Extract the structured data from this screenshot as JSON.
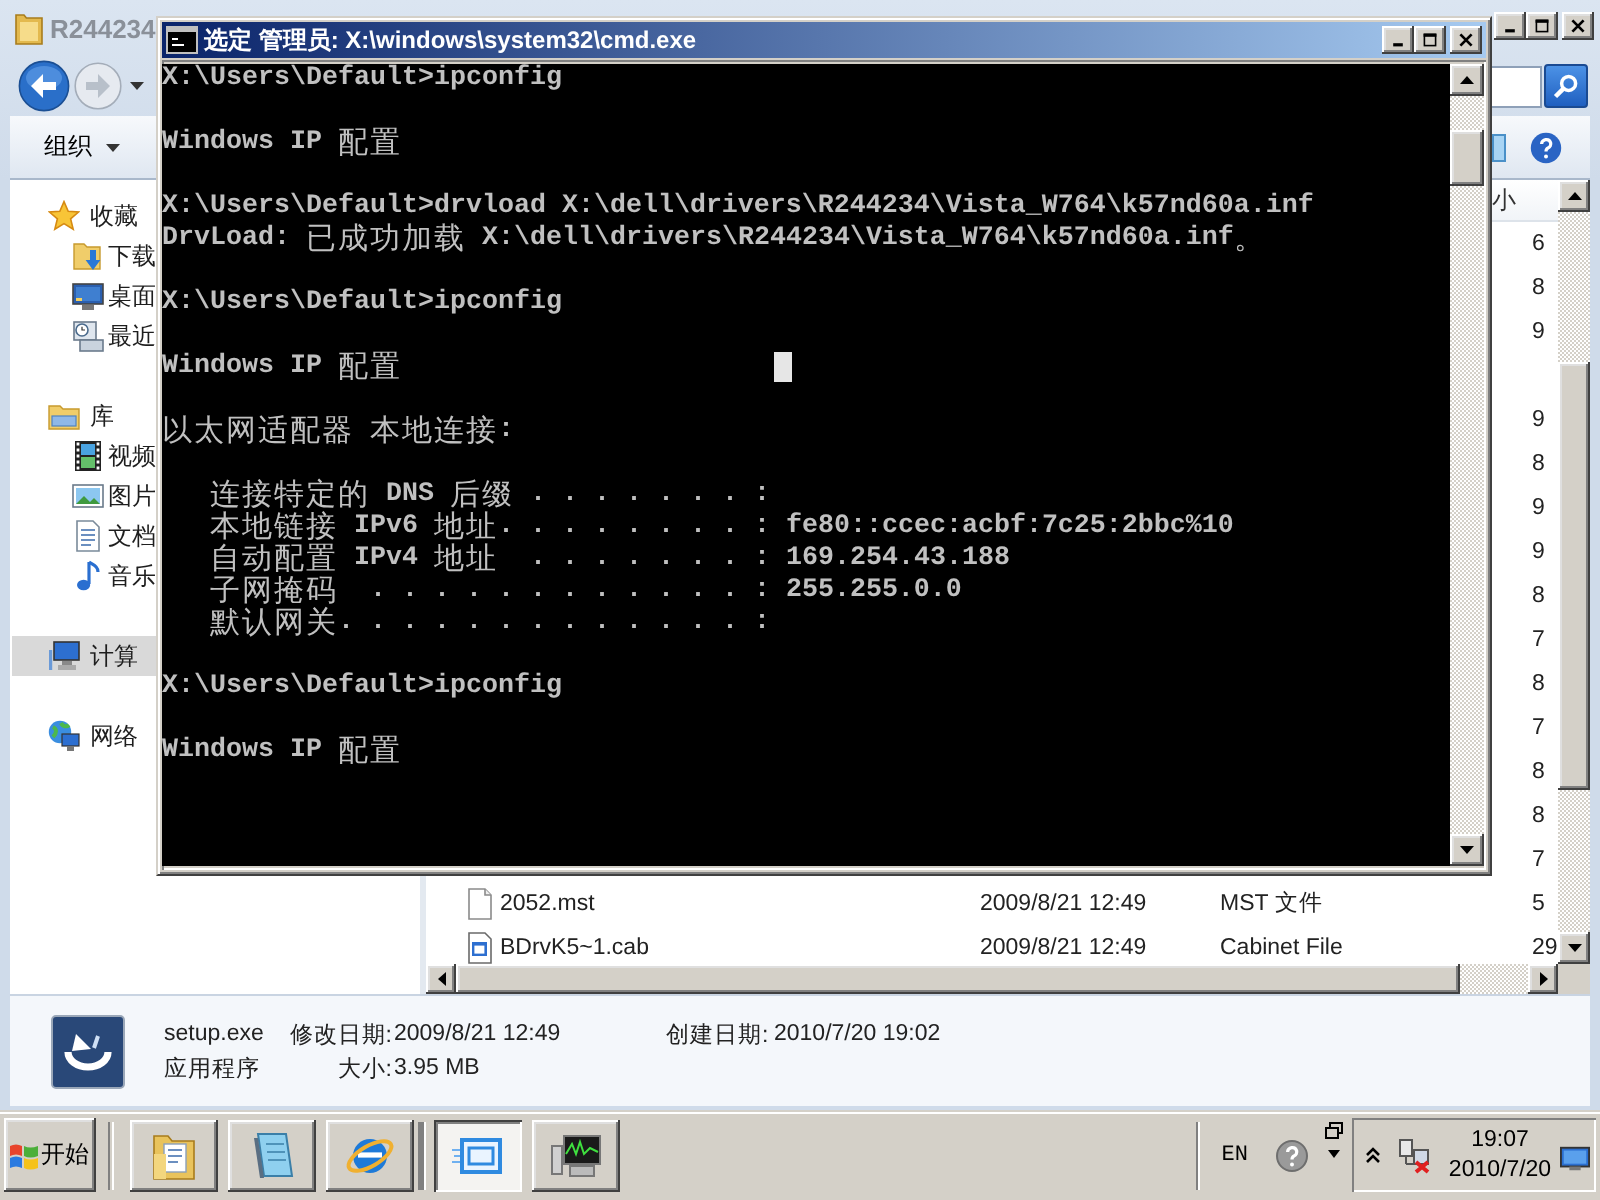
{
  "explorer": {
    "title": "R244234",
    "toolbar": {
      "organize": "组织"
    },
    "sidebar": [
      {
        "label": "收藏",
        "selected": false,
        "children": [
          {
            "label": "下载",
            "selected": false
          },
          {
            "label": "桌面",
            "selected": false
          },
          {
            "label": "最近",
            "selected": false
          }
        ]
      },
      {
        "label": "库",
        "selected": false,
        "children": [
          {
            "label": "视频",
            "selected": false
          },
          {
            "label": "图片",
            "selected": false
          },
          {
            "label": "文档",
            "selected": false
          },
          {
            "label": "音乐",
            "selected": false
          }
        ]
      },
      {
        "label": "计算",
        "selected": true
      },
      {
        "label": "网络",
        "selected": false
      }
    ],
    "file_list": {
      "columns": [
        {
          "label": "小"
        }
      ],
      "rows": [
        {
          "size": "6"
        },
        {
          "size": "8"
        },
        {
          "size": "9"
        },
        {
          "size": "9"
        },
        {
          "size": "8"
        },
        {
          "size": "9"
        },
        {
          "size": "9"
        },
        {
          "size": "8"
        },
        {
          "size": "7"
        },
        {
          "size": "8"
        },
        {
          "size": "7"
        },
        {
          "size": "8"
        },
        {
          "size": "8"
        },
        {
          "size": "7"
        },
        {
          "name": "2052.mst",
          "date": "2009/8/21 12:49",
          "type": "MST 文件",
          "size": "5"
        },
        {
          "name": "BDrvK5~1.cab",
          "date": "2009/8/21 12:49",
          "type": "Cabinet File",
          "size": "29"
        }
      ]
    },
    "details": {
      "name": "setup.exe",
      "modified_label": "修改日期:",
      "modified": "2009/8/21 12:49",
      "created_label": "创建日期:",
      "created": "2010/7/20 19:02",
      "type": "应用程序",
      "size_label": "大小:",
      "size": "3.95 MB"
    }
  },
  "console_window": {
    "title": "选定 管理员: X:\\windows\\system32\\cmd.exe",
    "lines": [
      {
        "kind": "prompt",
        "text": "X:\\Users\\Default>ipconfig"
      },
      {
        "kind": "heading",
        "text": "Windows IP 配置"
      },
      {
        "kind": "prompt",
        "text": "X:\\Users\\Default>drvload X:\\dell\\drivers\\R244234\\Vista_W764\\k57nd60a.inf"
      },
      {
        "kind": "output",
        "text": "DrvLoad: 已成功加载 X:\\dell\\drivers\\R244234\\Vista_W764\\k57nd60a.inf。"
      },
      {
        "kind": "prompt",
        "text": "X:\\Users\\Default>ipconfig"
      },
      {
        "kind": "heading",
        "text": "Windows IP 配置"
      },
      {
        "kind": "heading",
        "text": "以太网适配器 本地连接:"
      },
      {
        "kind": "field",
        "text": "连接特定的 DNS 后缀 . . . . . . . :"
      },
      {
        "kind": "field",
        "text": "本地链接 IPv6 地址. . . . . . . . : fe80::ccec:acbf:7c25:2bbc%10"
      },
      {
        "kind": "field",
        "text": "自动配置 IPv4 地址  . . . . . . . : 169.254.43.188"
      },
      {
        "kind": "field",
        "text": "子网掩码  . . . . . . . . . . . . : 255.255.0.0"
      },
      {
        "kind": "field",
        "text": "默认网关. . . . . . . . . . . . . :"
      },
      {
        "kind": "prompt",
        "text": "X:\\Users\\Default>ipconfig"
      },
      {
        "kind": "heading",
        "text": "Windows IP 配置"
      }
    ]
  },
  "taskbar": {
    "start": "开始",
    "tasks": [
      {
        "selected": false
      },
      {
        "selected": false
      },
      {
        "selected": false
      },
      {
        "selected": true
      },
      {
        "selected": false
      }
    ],
    "language": "EN",
    "clock": {
      "time": "19:07",
      "date": "2010/7/20"
    }
  }
}
